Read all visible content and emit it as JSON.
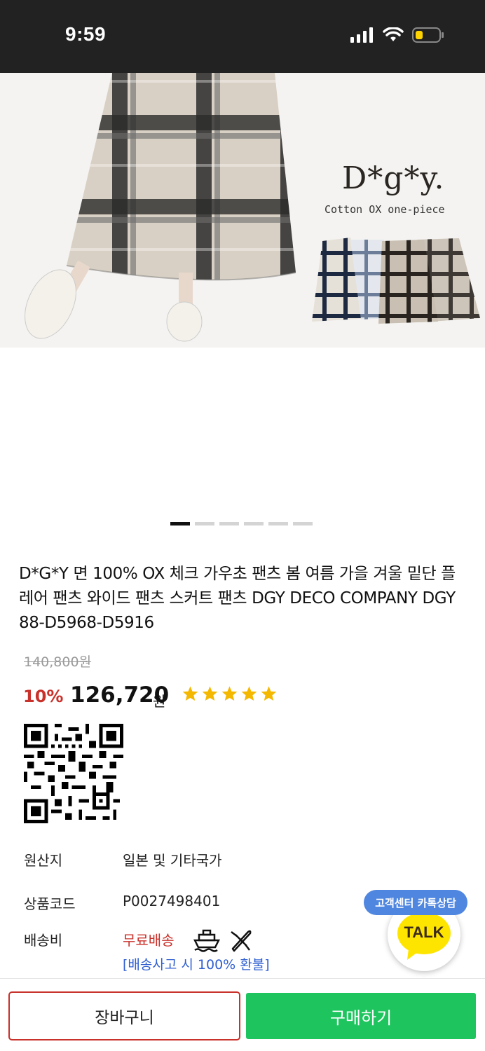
{
  "status_bar": {
    "time": "9:59",
    "icons": [
      "signal-icon",
      "wifi-icon",
      "battery-icon"
    ]
  },
  "hero": {
    "brand_logo": "D*g*y.",
    "brand_sub": "Cotton OX one-piece",
    "slide_count": 6,
    "active_slide": 1
  },
  "product": {
    "title": "D*G*Y 면 100% OX 체크 가우초 팬츠 봄 여름 가을 겨울 밑단 플레어 팬츠 와이드 팬츠 스커트 팬츠 DGY DECO COMPANY DGY 88-D5968-D5916",
    "original_price": "140,800원",
    "discount": "10%",
    "price": "126,720",
    "price_unit": "원",
    "rating_stars": 5
  },
  "info": {
    "origin_label": "원산지",
    "origin_value": "일본 및 기타국가",
    "code_label": "상품코드",
    "code_value": "P0027498401",
    "shipping_label": "배송비",
    "shipping_value": "무료배송",
    "refund_text": "[배송사고 시 100% 환불]"
  },
  "support": {
    "badge": "고객센터 카톡상담",
    "talk": "TALK"
  },
  "actions": {
    "cart_label": "장바구니",
    "buy_label": "구매하기"
  },
  "colors": {
    "accent_red": "#c9312b",
    "buy_green": "#1ec55e",
    "star_yellow": "#f5b800",
    "kakao_yellow": "#fee500",
    "link_blue": "#2f5fd1"
  }
}
